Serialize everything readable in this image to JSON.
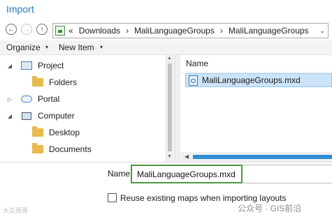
{
  "window": {
    "title": "Import"
  },
  "nav": {
    "back_glyph": "←",
    "forward_glyph": "→",
    "up_glyph": "↑",
    "breadcrumb_overflow": "«",
    "breadcrumbs": [
      "Downloads",
      "MaliLanguageGroups",
      "MaliLanguageGroups"
    ],
    "separator": "›",
    "dropdown_glyph": "⌄"
  },
  "toolbar": {
    "organize_label": "Organize",
    "new_item_label": "New Item",
    "caret": "▾"
  },
  "tree": {
    "items": [
      {
        "label": "Project",
        "arrow": "◢",
        "icon": "project-icon"
      },
      {
        "label": "Folders",
        "arrow": "",
        "icon": "folder-icon"
      },
      {
        "label": "Portal",
        "arrow": "▷",
        "icon": "cloud-icon"
      },
      {
        "label": "Computer",
        "arrow": "◢",
        "icon": "computer-icon"
      },
      {
        "label": "Desktop",
        "arrow": "",
        "icon": "folder-icon"
      },
      {
        "label": "Documents",
        "arrow": "",
        "icon": "folder-icon"
      }
    ],
    "scroll_up": "▲",
    "scroll_down": "▼"
  },
  "content": {
    "column_name": "Name",
    "files": [
      {
        "name": "MaliLanguageGroups.mxd",
        "icon": "mxd-file-icon"
      }
    ],
    "hscroll_left": "◀"
  },
  "name_field": {
    "label": "Name",
    "value": "MaliLanguageGroups.mxd"
  },
  "options": {
    "reuse_label": "Reuse existing maps when importing layouts",
    "reuse_checked": false
  },
  "watermarks": {
    "left": "大瓜哥哥",
    "right": "公众号 · GIS前沿"
  },
  "colors": {
    "accent": "#2b7bb9",
    "selection": "#cce4f7",
    "name_focus_border": "#4a9a3b"
  }
}
